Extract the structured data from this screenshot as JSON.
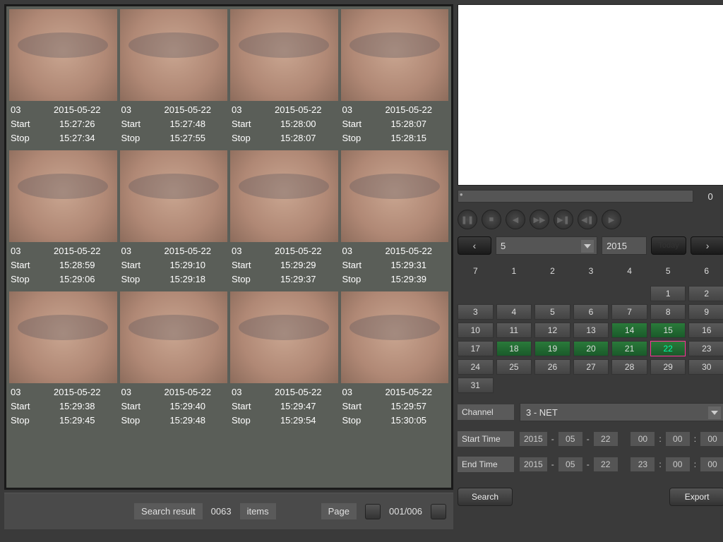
{
  "thumbs": [
    {
      "ch": "03",
      "date": "2015-05-22",
      "start": "15:27:26",
      "stop": "15:27:34"
    },
    {
      "ch": "03",
      "date": "2015-05-22",
      "start": "15:27:48",
      "stop": "15:27:55"
    },
    {
      "ch": "03",
      "date": "2015-05-22",
      "start": "15:28:00",
      "stop": "15:28:07"
    },
    {
      "ch": "03",
      "date": "2015-05-22",
      "start": "15:28:07",
      "stop": "15:28:15"
    },
    {
      "ch": "03",
      "date": "2015-05-22",
      "start": "15:28:59",
      "stop": "15:29:06"
    },
    {
      "ch": "03",
      "date": "2015-05-22",
      "start": "15:29:10",
      "stop": "15:29:18"
    },
    {
      "ch": "03",
      "date": "2015-05-22",
      "start": "15:29:29",
      "stop": "15:29:37"
    },
    {
      "ch": "03",
      "date": "2015-05-22",
      "start": "15:29:31",
      "stop": "15:29:39"
    },
    {
      "ch": "03",
      "date": "2015-05-22",
      "start": "15:29:38",
      "stop": "15:29:45"
    },
    {
      "ch": "03",
      "date": "2015-05-22",
      "start": "15:29:40",
      "stop": "15:29:48"
    },
    {
      "ch": "03",
      "date": "2015-05-22",
      "start": "15:29:47",
      "stop": "15:29:54"
    },
    {
      "ch": "03",
      "date": "2015-05-22",
      "start": "15:29:57",
      "stop": "15:30:05"
    }
  ],
  "meta_labels": {
    "start": "Start",
    "stop": "Stop"
  },
  "footer": {
    "result_label": "Search result",
    "result_count": "0063",
    "items_label": "items",
    "page_label": "Page",
    "page_value": "001/006"
  },
  "progress": {
    "value": "0"
  },
  "calendar": {
    "month": "5",
    "year": "2015",
    "today_label": "Today",
    "weekdays": [
      "7",
      "1",
      "2",
      "3",
      "4",
      "5",
      "6"
    ],
    "days": [
      {
        "n": "",
        "cls": "empty"
      },
      {
        "n": "",
        "cls": "empty"
      },
      {
        "n": "",
        "cls": "empty"
      },
      {
        "n": "",
        "cls": "empty"
      },
      {
        "n": "",
        "cls": "empty"
      },
      {
        "n": "1",
        "cls": ""
      },
      {
        "n": "2",
        "cls": ""
      },
      {
        "n": "3",
        "cls": ""
      },
      {
        "n": "4",
        "cls": ""
      },
      {
        "n": "5",
        "cls": ""
      },
      {
        "n": "6",
        "cls": ""
      },
      {
        "n": "7",
        "cls": ""
      },
      {
        "n": "8",
        "cls": ""
      },
      {
        "n": "9",
        "cls": ""
      },
      {
        "n": "10",
        "cls": ""
      },
      {
        "n": "11",
        "cls": ""
      },
      {
        "n": "12",
        "cls": ""
      },
      {
        "n": "13",
        "cls": ""
      },
      {
        "n": "14",
        "cls": "green"
      },
      {
        "n": "15",
        "cls": "green"
      },
      {
        "n": "16",
        "cls": ""
      },
      {
        "n": "17",
        "cls": ""
      },
      {
        "n": "18",
        "cls": "green"
      },
      {
        "n": "19",
        "cls": "green"
      },
      {
        "n": "20",
        "cls": "green"
      },
      {
        "n": "21",
        "cls": "green"
      },
      {
        "n": "22",
        "cls": "green sel"
      },
      {
        "n": "23",
        "cls": ""
      },
      {
        "n": "24",
        "cls": ""
      },
      {
        "n": "25",
        "cls": ""
      },
      {
        "n": "26",
        "cls": ""
      },
      {
        "n": "27",
        "cls": ""
      },
      {
        "n": "28",
        "cls": ""
      },
      {
        "n": "29",
        "cls": ""
      },
      {
        "n": "30",
        "cls": ""
      },
      {
        "n": "31",
        "cls": ""
      }
    ]
  },
  "channel": {
    "label": "Channel",
    "value": "3 - NET"
  },
  "start_time": {
    "label": "Start Time",
    "y": "2015",
    "m": "05",
    "d": "22",
    "hh": "00",
    "mm": "00",
    "ss": "00"
  },
  "end_time": {
    "label": "End Time",
    "y": "2015",
    "m": "05",
    "d": "22",
    "hh": "23",
    "mm": "00",
    "ss": "00"
  },
  "buttons": {
    "search": "Search",
    "export": "Export"
  },
  "play_icons": [
    "❚❚",
    "■",
    "◀",
    "▶▶",
    "▶❚",
    "◀❚",
    "▶"
  ]
}
